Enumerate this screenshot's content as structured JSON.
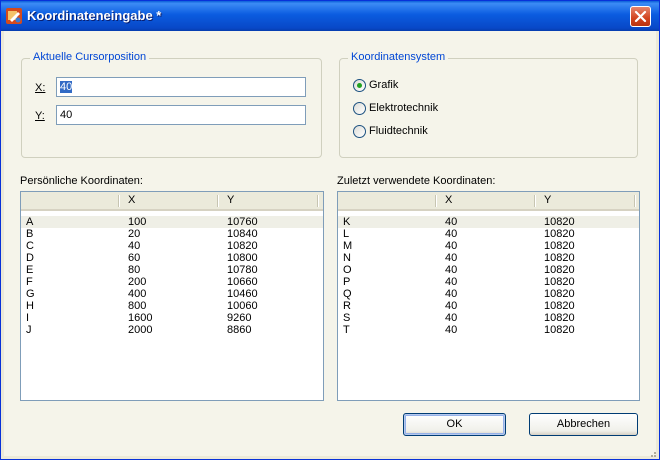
{
  "window": {
    "title": "Koordinateneingabe *"
  },
  "cursor_group": {
    "legend": "Aktuelle Cursorposition",
    "x_label": "X:",
    "x_value": "40",
    "y_label": "Y:",
    "y_value": "40"
  },
  "system_group": {
    "legend": "Koordinatensystem",
    "options": [
      "Grafik",
      "Elektrotechnik",
      "Fluidtechnik"
    ],
    "selected": "Grafik"
  },
  "personal": {
    "label": "Persönliche Koordinaten:",
    "columns": [
      "",
      "X",
      "Y"
    ],
    "rows": [
      [
        "A",
        "100",
        "10760"
      ],
      [
        "B",
        "20",
        "10840"
      ],
      [
        "C",
        "40",
        "10820"
      ],
      [
        "D",
        "60",
        "10800"
      ],
      [
        "E",
        "80",
        "10780"
      ],
      [
        "F",
        "200",
        "10660"
      ],
      [
        "G",
        "400",
        "10460"
      ],
      [
        "H",
        "800",
        "10060"
      ],
      [
        "I",
        "1600",
        "9260"
      ],
      [
        "J",
        "2000",
        "8860"
      ]
    ]
  },
  "recent": {
    "label": "Zuletzt verwendete Koordinaten:",
    "columns": [
      "",
      "X",
      "Y"
    ],
    "rows": [
      [
        "K",
        "40",
        "10820"
      ],
      [
        "L",
        "40",
        "10820"
      ],
      [
        "M",
        "40",
        "10820"
      ],
      [
        "N",
        "40",
        "10820"
      ],
      [
        "O",
        "40",
        "10820"
      ],
      [
        "P",
        "40",
        "10820"
      ],
      [
        "Q",
        "40",
        "10820"
      ],
      [
        "R",
        "40",
        "10820"
      ],
      [
        "S",
        "40",
        "10820"
      ],
      [
        "T",
        "40",
        "10820"
      ]
    ]
  },
  "buttons": {
    "ok": "OK",
    "cancel": "Abbrechen"
  },
  "colors": {
    "title_bar": "#0a5fd8",
    "legend_text": "#0046d5",
    "close_button": "#d2431e",
    "radio_checked": "#21a121"
  }
}
